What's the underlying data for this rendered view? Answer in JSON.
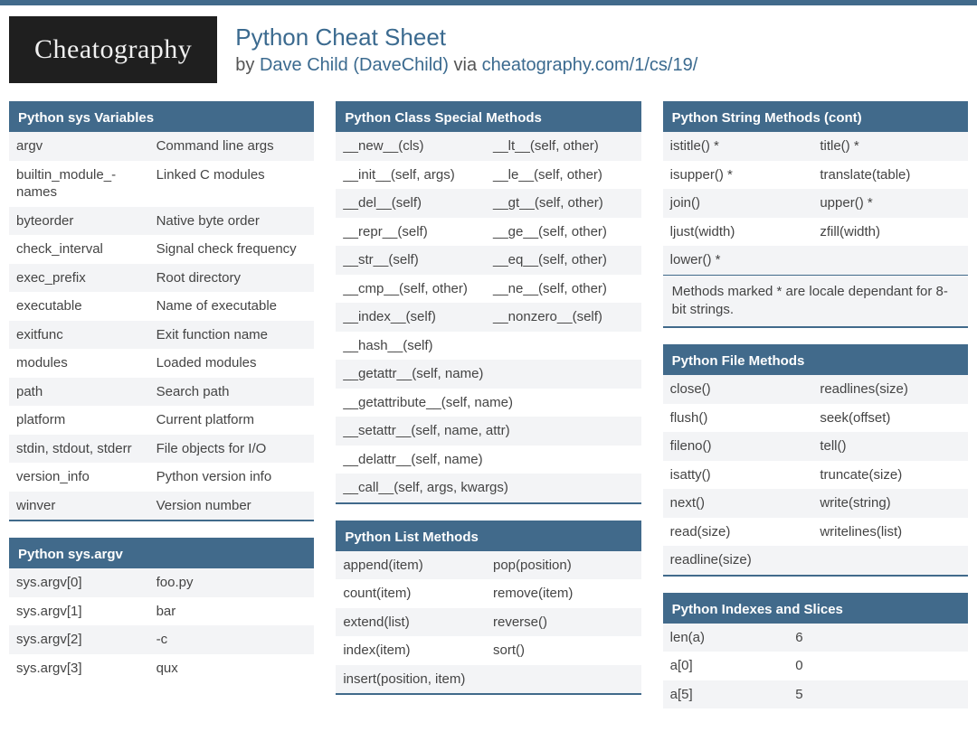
{
  "logo": "Cheatography",
  "title": "Python Cheat Sheet",
  "by": "by ",
  "author": "Dave Child (DaveChild)",
  "via": " via ",
  "url": "cheatography.com/1/cs/19/",
  "cards": {
    "sysvars": {
      "title": "Python sys Variables",
      "rows": [
        [
          "argv",
          "Command line args"
        ],
        [
          "builtin_module_-names",
          "Linked C modules"
        ],
        [
          "byteorder",
          "Native byte order"
        ],
        [
          "check_interval",
          "Signal check frequency"
        ],
        [
          "exec_prefix",
          "Root directory"
        ],
        [
          "executable",
          "Name of executable"
        ],
        [
          "exitfunc",
          "Exit function name"
        ],
        [
          "modules",
          "Loaded modules"
        ],
        [
          "path",
          "Search path"
        ],
        [
          "platform",
          "Current platform"
        ],
        [
          "stdin, stdout, stderr",
          "File objects for I/O"
        ],
        [
          "version_info",
          "Python version info"
        ],
        [
          "winver",
          "Version number"
        ]
      ]
    },
    "sysargv": {
      "title": "Python sys.argv",
      "rows": [
        [
          "sys.argv[0]",
          "foo.py"
        ],
        [
          "sys.argv[1]",
          "bar"
        ],
        [
          "sys.argv[2]",
          "-c"
        ],
        [
          "sys.argv[3]",
          "qux"
        ]
      ]
    },
    "special": {
      "title": "Python Class Special Methods",
      "rows2": [
        [
          "__new__(cls)",
          "__lt__(self, other)"
        ],
        [
          "__init__(self, args)",
          "__le__(self, other)"
        ],
        [
          "__del__(self)",
          "__gt__(self, other)"
        ],
        [
          "__repr__(self)",
          "__ge__(self, other)"
        ],
        [
          "__str__(self)",
          "__eq__(self, other)"
        ],
        [
          "__cmp__(self, other)",
          "__ne__(self, other)"
        ],
        [
          "__index__(self)",
          "__nonzero__(self)"
        ]
      ],
      "rows1": [
        "__hash__(self)",
        "__getattr__(self, name)",
        "__getattribute__(self, name)",
        "__setattr__(self, name, attr)",
        "__delattr__(self, name)",
        "__call__(self, args, kwargs)"
      ]
    },
    "list": {
      "title": "Python List Methods",
      "rows2": [
        [
          "append(item)",
          "pop(position)"
        ],
        [
          "count(item)",
          "remove(item)"
        ],
        [
          "extend(list)",
          "reverse()"
        ],
        [
          "index(item)",
          "sort()"
        ]
      ],
      "rows1": [
        "insert(position, item)"
      ]
    },
    "string": {
      "title": "Python String Methods (cont)",
      "rows2": [
        [
          "istitle() *",
          "title() *"
        ],
        [
          "isupper() *",
          "translate(table)"
        ],
        [
          "join()",
          "upper() *"
        ],
        [
          "ljust(width)",
          "zfill(width)"
        ]
      ],
      "rows1": [
        "lower() *"
      ],
      "note": "Methods marked * are locale dependant for 8-bit strings."
    },
    "file": {
      "title": "Python File Methods",
      "rows2": [
        [
          "close()",
          "readlines(size)"
        ],
        [
          "flush()",
          "seek(offset)"
        ],
        [
          "fileno()",
          "tell()"
        ],
        [
          "isatty()",
          "truncate(size)"
        ],
        [
          "next()",
          "write(string)"
        ],
        [
          "read(size)",
          "writelines(list)"
        ]
      ],
      "rows1": [
        "readline(size)"
      ]
    },
    "indexes": {
      "title": "Python Indexes and Slices",
      "rows": [
        [
          "len(a)",
          "6"
        ],
        [
          "a[0]",
          "0"
        ],
        [
          "a[5]",
          "5"
        ]
      ]
    }
  }
}
